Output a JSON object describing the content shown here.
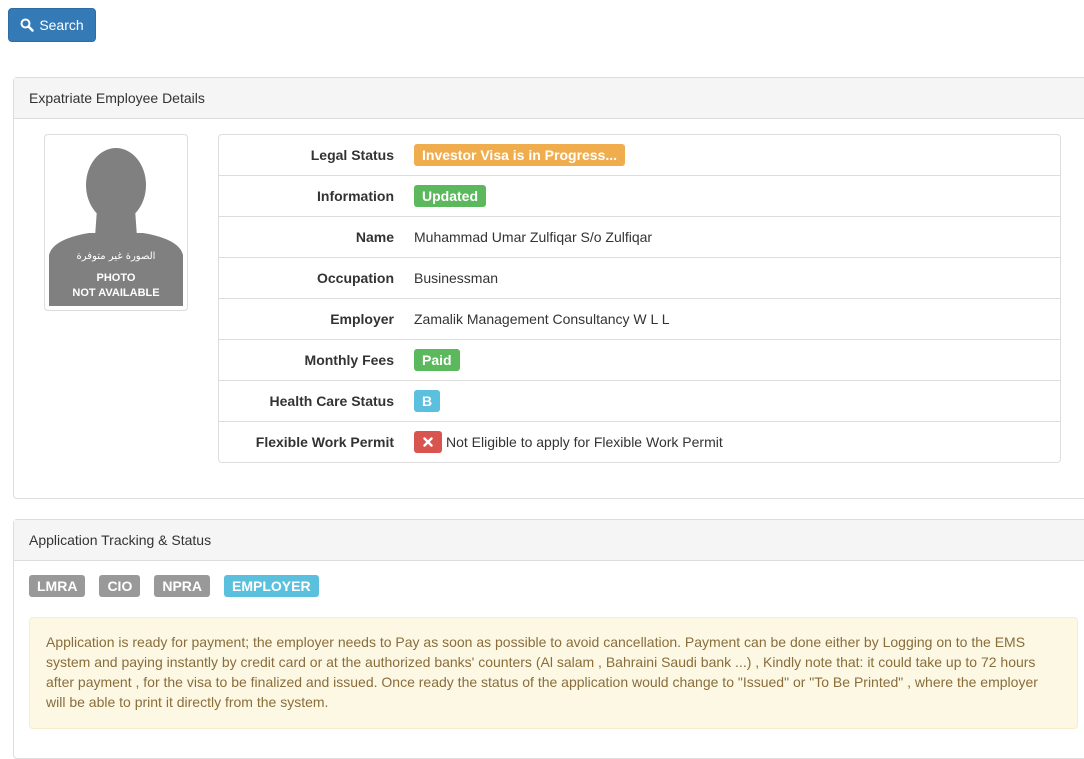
{
  "toolbar": {
    "search_label": "Search",
    "search_icon": "search-icon"
  },
  "employee_panel": {
    "title": "Expatriate Employee Details",
    "photo": {
      "text_ar": "الصورة غير متوفرة",
      "line1": "PHOTO",
      "line2": "NOT AVAILABLE"
    },
    "rows": [
      {
        "label": "Legal Status",
        "value": "Investor Visa is in Progress...",
        "kind": "badge",
        "color": "#f0ad4e"
      },
      {
        "label": "Information",
        "value": "Updated",
        "kind": "badge",
        "color": "#5cb85c"
      },
      {
        "label": "Name",
        "value": "Muhammad Umar Zulfiqar S/o Zulfiqar",
        "kind": "text"
      },
      {
        "label": "Occupation",
        "value": "Businessman",
        "kind": "text"
      },
      {
        "label": "Employer",
        "value": "Zamalik Management Consultancy W L L",
        "kind": "text"
      },
      {
        "label": "Monthly Fees",
        "value": "Paid",
        "kind": "badge",
        "color": "#5cb85c"
      },
      {
        "label": "Health Care Status",
        "value": "B",
        "kind": "badge",
        "color": "#5bc0de"
      },
      {
        "label": "Flexible Work Permit",
        "value": "Not Eligible to apply for Flexible Work Permit",
        "kind": "icon-text",
        "icon": "close-icon",
        "color": "#d9534f"
      }
    ]
  },
  "tracking_panel": {
    "title": "Application Tracking & Status",
    "stages": [
      {
        "label": "LMRA",
        "color": "#999999"
      },
      {
        "label": "CIO",
        "color": "#999999"
      },
      {
        "label": "NPRA",
        "color": "#999999"
      },
      {
        "label": "EMPLOYER",
        "color": "#5bc0de"
      }
    ],
    "message": "Application is ready for payment; the employer needs to Pay as soon as possible to avoid cancellation. Payment can be done either by Logging on to the EMS system and paying instantly by credit card or at the authorized banks' counters (Al salam , Bahraini Saudi bank ...) , Kindly note that: it could take up to 72 hours after payment , for the visa to be finalized and issued. Once ready the status of the application would change to \"Issued\" or \"To Be Printed\" , where the employer will be able to print it directly from the system."
  }
}
